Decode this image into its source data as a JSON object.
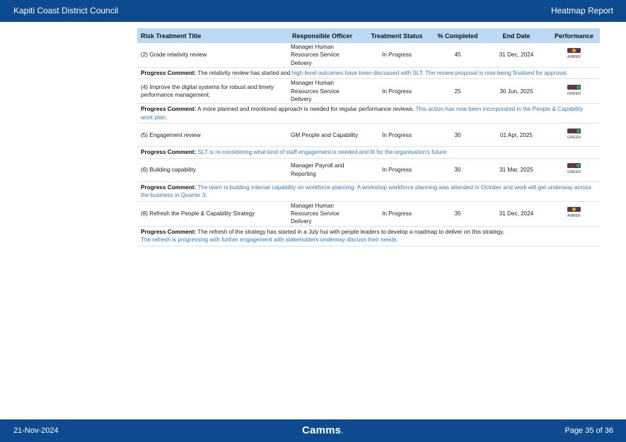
{
  "header": {
    "org": "Kapiti Coast District Council",
    "report": "Heatmap Report"
  },
  "columns": {
    "title": "Risk Treatment Title",
    "officer": "Responsible Officer",
    "status": "Treatment Status",
    "completed": "% Completed",
    "end_date": "End Date",
    "performance": "Performance"
  },
  "rows": [
    {
      "title": "(2) Grade relativity review",
      "officer": "Manager Human Resources Service Delivery",
      "status": "In Progress",
      "completed": "45",
      "end_date": "31 Dec, 2024",
      "performance": "AMBER",
      "comment_label": "Progress Comment:",
      "comment_black": "The relativity review has started and",
      "comment_blue": "high level outcomes have been discussed with SLT. The review proposal is now being finalised for approval."
    },
    {
      "title": "(4) Improve the digital systems for robust and timely performance management.",
      "officer": "Manager Human Resources Service Delivery",
      "status": "In Progress",
      "completed": "25",
      "end_date": "30 Jun, 2025",
      "performance": "GREEN",
      "comment_label": "Progress Comment:",
      "comment_black": "A more planned and monitored approach is needed for regular performance reviews.",
      "comment_blue": "This action has now been incorporated in the People & Capability work plan."
    },
    {
      "title": "(5) Engagement review",
      "officer": "GM People and Capability",
      "status": "In Progress",
      "completed": "30",
      "end_date": "01 Apr, 2025",
      "performance": "GREEN",
      "comment_label": "Progress Comment:",
      "comment_black": "",
      "comment_blue": "SLT is re-considering what kind of staff engagement is needed and fit for the organisation's future."
    },
    {
      "title": "(6) Building capability",
      "officer": "Manager Payroll and Reporting",
      "status": "In Progress",
      "completed": "30",
      "end_date": "31 Mar, 2025",
      "performance": "GREEN",
      "comment_label": "Progress Comment:",
      "comment_black": "",
      "comment_blue": "The team is building internal capability on workforce planning. A workshop workforce planning was attended in October  and work will get underway across the business in Quarter 3."
    },
    {
      "title": "(8) Refresh the People & Capability Strategy",
      "officer": "Manager Human Resources Service Delivery",
      "status": "In Progress",
      "completed": "35",
      "end_date": "31 Dec, 2024",
      "performance": "AMBER",
      "comment_label": "Progress Comment:",
      "comment_black": "The refresh of the strategy has started in a July hui with people leaders to develop a roadmap to deliver on this strategy.",
      "comment_blue": "The refresh is progressing with further engagement with stakeholders underway discuss their needs."
    }
  ],
  "colors": {
    "amber": "#f2a21c",
    "green": "#2fa84f",
    "off": "#7a2b2b",
    "header_bg": "#0d4a8f",
    "table_header_bg": "#bcd9f4",
    "comment_blue": "#3378c9"
  },
  "footer": {
    "date": "21-Nov-2024",
    "brand": "Camms",
    "brand_dot": ".",
    "page": "Page 35 of 36"
  }
}
